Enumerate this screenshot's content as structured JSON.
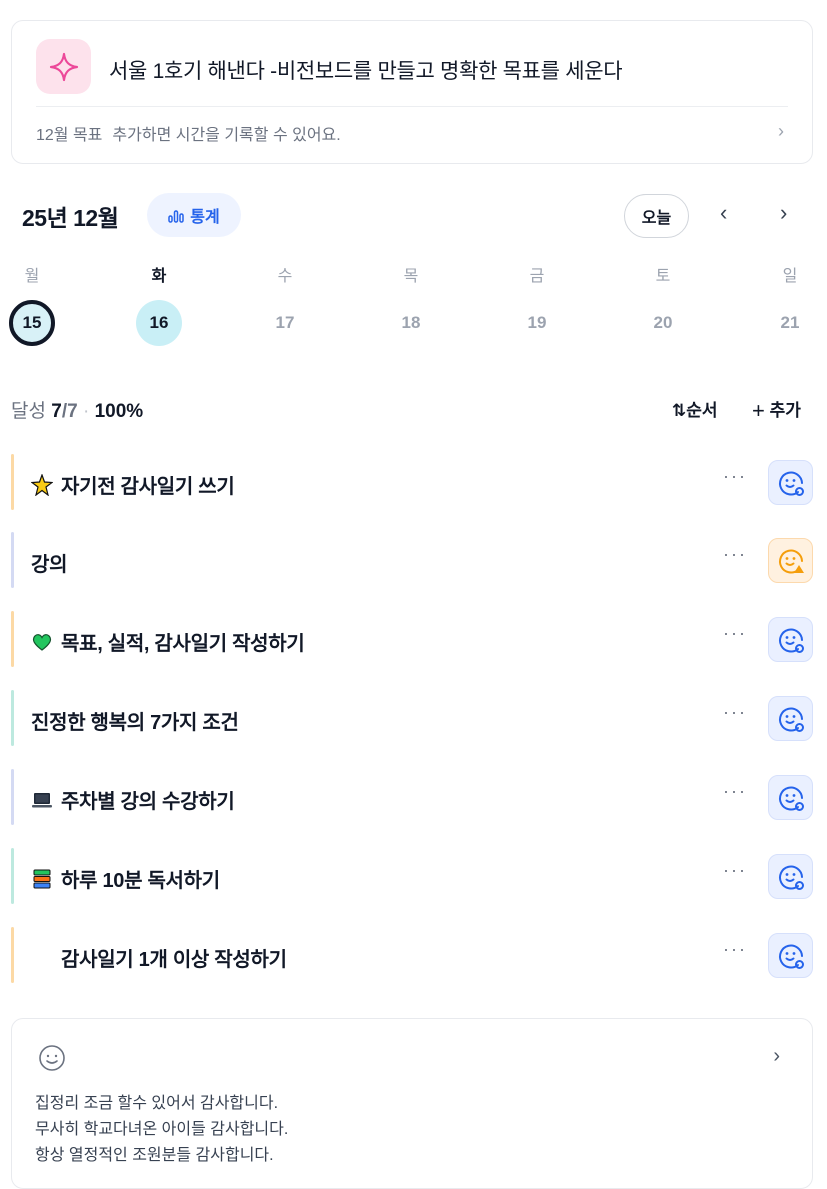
{
  "goal": {
    "title": "서울 1호기 해낸다 -비전보드를 만들고 명확한 목표를 세운다",
    "sub_label": "12월 목표",
    "sub_hint": "추가하면 시간을 기록할 수 있어요.",
    "icon": "sparkle-icon"
  },
  "calendar": {
    "month_title": "25년 12월",
    "stats_label": "통계",
    "today_label": "오늘",
    "weekdays": [
      "월",
      "화",
      "수",
      "목",
      "금",
      "토",
      "일"
    ],
    "days": [
      "15",
      "16",
      "17",
      "18",
      "19",
      "20",
      "21"
    ]
  },
  "summary": {
    "prefix": "달성",
    "done": "7",
    "total": "/7",
    "dot": "·",
    "percent": "100%",
    "order_label": "순서",
    "add_label": "추가"
  },
  "tasks": [
    {
      "label": "자기전 감사일기 쓰기",
      "emoji": "sparkle-star",
      "color": "#fcd9a5",
      "status": "done"
    },
    {
      "label": "강의",
      "emoji": "",
      "color": "#d4daf3",
      "status": "warn"
    },
    {
      "label": "목표, 실적, 감사일기 작성하기",
      "emoji": "green-heart",
      "color": "#fcd9a5",
      "status": "done"
    },
    {
      "label": "진정한 행복의 7가지 조건",
      "emoji": "",
      "color": "#bde9df",
      "status": "done"
    },
    {
      "label": "주차별 강의 수강하기",
      "emoji": "laptop",
      "color": "#d4daf3",
      "status": "done"
    },
    {
      "label": "하루 10분 독서하기",
      "emoji": "books",
      "color": "#bde9df",
      "status": "done"
    },
    {
      "label": "감사일기 1개 이상 작성하기",
      "emoji": "",
      "color": "#fcd9a5",
      "status": "done"
    }
  ],
  "thanks": {
    "lines": [
      "집정리 조금 할수 있어서 감사합니다.",
      "무사히 학교다녀온 아이들 감사합니다.",
      "항상 열정적인 조원분들 감사합니다."
    ]
  }
}
